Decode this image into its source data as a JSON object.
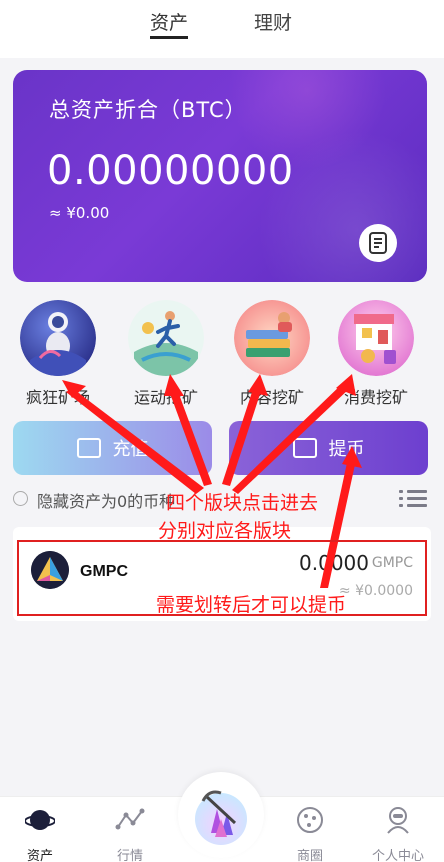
{
  "tabs": {
    "assets": "资产",
    "finance": "理财"
  },
  "card": {
    "title": "总资产折合（BTC）",
    "amount": "0.00000000",
    "cny": "≈ ¥0.00",
    "icon": "note-icon"
  },
  "modules": [
    {
      "label": "疯狂矿场",
      "icon": "astronaut-icon"
    },
    {
      "label": "运动挖矿",
      "icon": "runner-icon"
    },
    {
      "label": "内容挖矿",
      "icon": "books-icon"
    },
    {
      "label": "消费挖矿",
      "icon": "shopping-icon"
    }
  ],
  "actions": {
    "deposit": "充值",
    "withdraw": "提币"
  },
  "hide_zero_label": "隐藏资产为0的币种",
  "coins": [
    {
      "name": "GMPC",
      "amount": "0.0000",
      "unit": "GMPC",
      "cny": "≈ ¥0.0000"
    }
  ],
  "annotations": {
    "line1": "四个版块点击进去",
    "line2": "分别对应各版块",
    "line3": "需要划转后才可以提币"
  },
  "bottom_nav": [
    {
      "label": "资产",
      "icon": "planet-icon"
    },
    {
      "label": "行情",
      "icon": "chart-icon"
    },
    {
      "label": "",
      "icon": "crystal-icon"
    },
    {
      "label": "商圈",
      "icon": "cookie-icon"
    },
    {
      "label": "个人中心",
      "icon": "person-icon"
    }
  ],
  "colors": {
    "card_gradient": "#6a34c8",
    "withdraw": "#6d3fcf",
    "annotation": "#ff1a1a"
  }
}
